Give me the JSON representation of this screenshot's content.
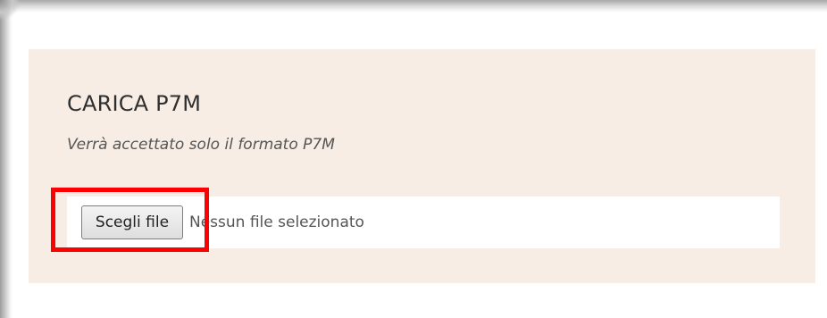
{
  "upload": {
    "title": "CARICA P7M",
    "subtitle": "Verrà accettato solo il formato P7M",
    "file_input": {
      "button_label": "Scegli file",
      "status_text": "Nessun file selezionato"
    }
  },
  "colors": {
    "panel_background": "#f7ede4",
    "input_background": "#ffffff",
    "highlight": "#ff0000"
  }
}
